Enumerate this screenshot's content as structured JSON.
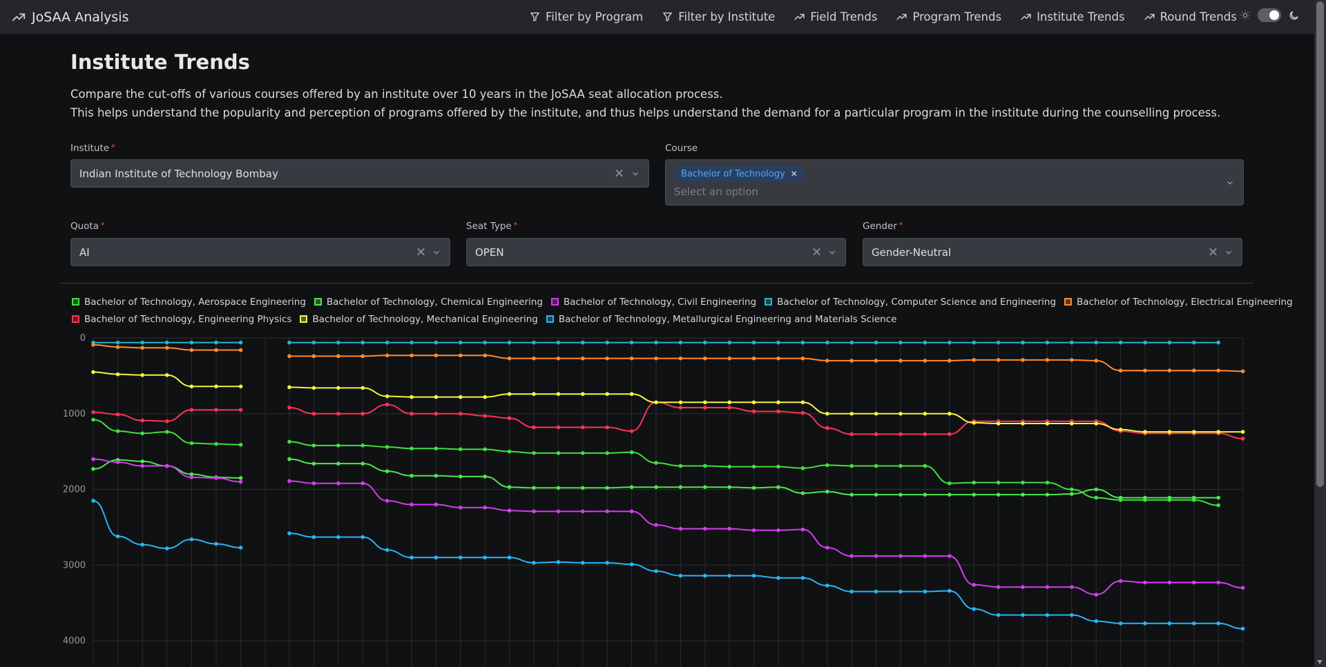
{
  "nav": {
    "brand": "JoSAA Analysis",
    "links": [
      "Filter by Program",
      "Filter by Institute",
      "Field Trends",
      "Program Trends",
      "Institute Trends",
      "Round Trends"
    ]
  },
  "page": {
    "title": "Institute Trends",
    "desc1": "Compare the cut-offs of various courses offered by an institute over 10 years in the JoSAA seat allocation process.",
    "desc2": "This helps understand the popularity and perception of programs offered by the institute, and thus helps understand the demand for a particular program in the institute during the counselling process."
  },
  "form": {
    "institute_label": "Institute",
    "institute_value": "Indian Institute of Technology Bombay",
    "course_label": "Course",
    "course_tag": "Bachelor of Technology",
    "course_placeholder": "Select an option",
    "quota_label": "Quota",
    "quota_value": "AI",
    "seat_label": "Seat Type",
    "seat_value": "OPEN",
    "gender_label": "Gender",
    "gender_value": "Gender-Neutral"
  },
  "chart_data": {
    "type": "line",
    "y_reversed": true,
    "grid": true,
    "legend_position": "top",
    "ylim": [
      0,
      4000
    ],
    "y_ticks": [
      "0",
      "1000",
      "2000",
      "3000",
      "4000"
    ],
    "series": [
      {
        "name": "Bachelor of Technology, Aerospace Engineering",
        "color": "#40e040",
        "seg1": [
          1080,
          1230,
          1260,
          1240,
          1390,
          1400,
          1410
        ],
        "seg2": [
          1370,
          1420,
          1420,
          1420,
          1440,
          1460,
          1460,
          1470,
          1470,
          1500,
          1520,
          1520,
          1520,
          1520,
          1510,
          1650,
          1690,
          1690,
          1700,
          1700,
          1700,
          1720,
          1680,
          1690,
          1690,
          1690,
          1690,
          1920,
          1910,
          1910,
          1910,
          1910,
          2000,
          2110,
          2140,
          2140,
          2140,
          2140,
          2210
        ]
      },
      {
        "name": "Bachelor of Technology, Chemical Engineering",
        "color": "#4de84d",
        "seg1": [
          1730,
          1610,
          1630,
          1690,
          1800,
          1840,
          1850
        ],
        "seg2": [
          1600,
          1660,
          1660,
          1660,
          1760,
          1820,
          1820,
          1830,
          1830,
          1970,
          1980,
          1980,
          1980,
          1980,
          1970,
          1970,
          1970,
          1970,
          1970,
          1980,
          1970,
          2050,
          2030,
          2070,
          2070,
          2070,
          2070,
          2070,
          2070,
          2070,
          2070,
          2070,
          2060,
          2000,
          2110,
          2110,
          2110,
          2110,
          2110
        ]
      },
      {
        "name": "Bachelor of Technology, Civil Engineering",
        "color": "#d63cf2",
        "seg1": [
          1600,
          1640,
          1690,
          1690,
          1840,
          1850,
          1900
        ],
        "seg2": [
          1890,
          1920,
          1920,
          1920,
          2150,
          2200,
          2200,
          2240,
          2240,
          2280,
          2290,
          2290,
          2290,
          2290,
          2290,
          2470,
          2520,
          2520,
          2520,
          2540,
          2540,
          2530,
          2770,
          2880,
          2880,
          2880,
          2880,
          2880,
          3260,
          3290,
          3290,
          3290,
          3290,
          3390,
          3210,
          3230,
          3230,
          3230,
          3230,
          3300
        ]
      },
      {
        "name": "Bachelor of Technology, Computer Science and Engineering",
        "color": "#22b8cf",
        "seg1": [
          60,
          60,
          60,
          60,
          60,
          60,
          60
        ],
        "seg2": [
          60,
          60,
          60,
          60,
          60,
          60,
          60,
          60,
          60,
          60,
          60,
          60,
          60,
          60,
          60,
          60,
          60,
          60,
          60,
          60,
          60,
          60,
          60,
          60,
          60,
          60,
          60,
          60,
          60,
          60,
          60,
          60,
          60,
          60,
          60,
          60,
          60,
          60,
          60
        ]
      },
      {
        "name": "Bachelor of Technology, Electrical Engineering",
        "color": "#ff8c30",
        "seg1": [
          90,
          120,
          130,
          130,
          160,
          160,
          160
        ],
        "seg2": [
          240,
          240,
          240,
          240,
          230,
          230,
          230,
          230,
          230,
          270,
          270,
          270,
          270,
          270,
          270,
          270,
          270,
          270,
          270,
          270,
          270,
          270,
          300,
          300,
          300,
          300,
          300,
          300,
          290,
          290,
          290,
          290,
          290,
          300,
          430,
          430,
          430,
          430,
          430,
          440
        ]
      },
      {
        "name": "Bachelor of Technology, Engineering Physics",
        "color": "#ff3355",
        "seg1": [
          980,
          1010,
          1090,
          1100,
          950,
          950,
          950
        ],
        "seg2": [
          920,
          1000,
          1000,
          1000,
          880,
          1000,
          1000,
          1000,
          1030,
          1060,
          1180,
          1180,
          1180,
          1180,
          1230,
          850,
          920,
          920,
          920,
          970,
          970,
          990,
          1190,
          1270,
          1270,
          1270,
          1270,
          1270,
          1100,
          1100,
          1100,
          1100,
          1100,
          1100,
          1230,
          1260,
          1260,
          1260,
          1260,
          1330
        ]
      },
      {
        "name": "Bachelor of Technology, Mechanical Engineering",
        "color": "#f5f542",
        "seg1": [
          450,
          480,
          490,
          490,
          640,
          640,
          640
        ],
        "seg2": [
          650,
          660,
          660,
          660,
          770,
          780,
          780,
          780,
          780,
          740,
          740,
          740,
          740,
          740,
          740,
          850,
          850,
          850,
          850,
          850,
          850,
          850,
          1000,
          1000,
          1000,
          1000,
          1000,
          1000,
          1120,
          1130,
          1130,
          1130,
          1130,
          1130,
          1210,
          1240,
          1240,
          1240,
          1240,
          1240
        ]
      },
      {
        "name": "Bachelor of Technology, Metallurgical Engineering and Materials Science",
        "color": "#29b6f6",
        "seg1": [
          2150,
          2620,
          2730,
          2780,
          2660,
          2720,
          2770
        ],
        "seg2": [
          2580,
          2630,
          2630,
          2630,
          2800,
          2900,
          2900,
          2900,
          2900,
          2900,
          2970,
          2960,
          2970,
          2970,
          2990,
          3080,
          3140,
          3140,
          3140,
          3140,
          3170,
          3170,
          3270,
          3350,
          3350,
          3350,
          3350,
          3340,
          3580,
          3660,
          3660,
          3660,
          3660,
          3740,
          3770,
          3770,
          3770,
          3770,
          3770,
          3840
        ]
      }
    ]
  }
}
